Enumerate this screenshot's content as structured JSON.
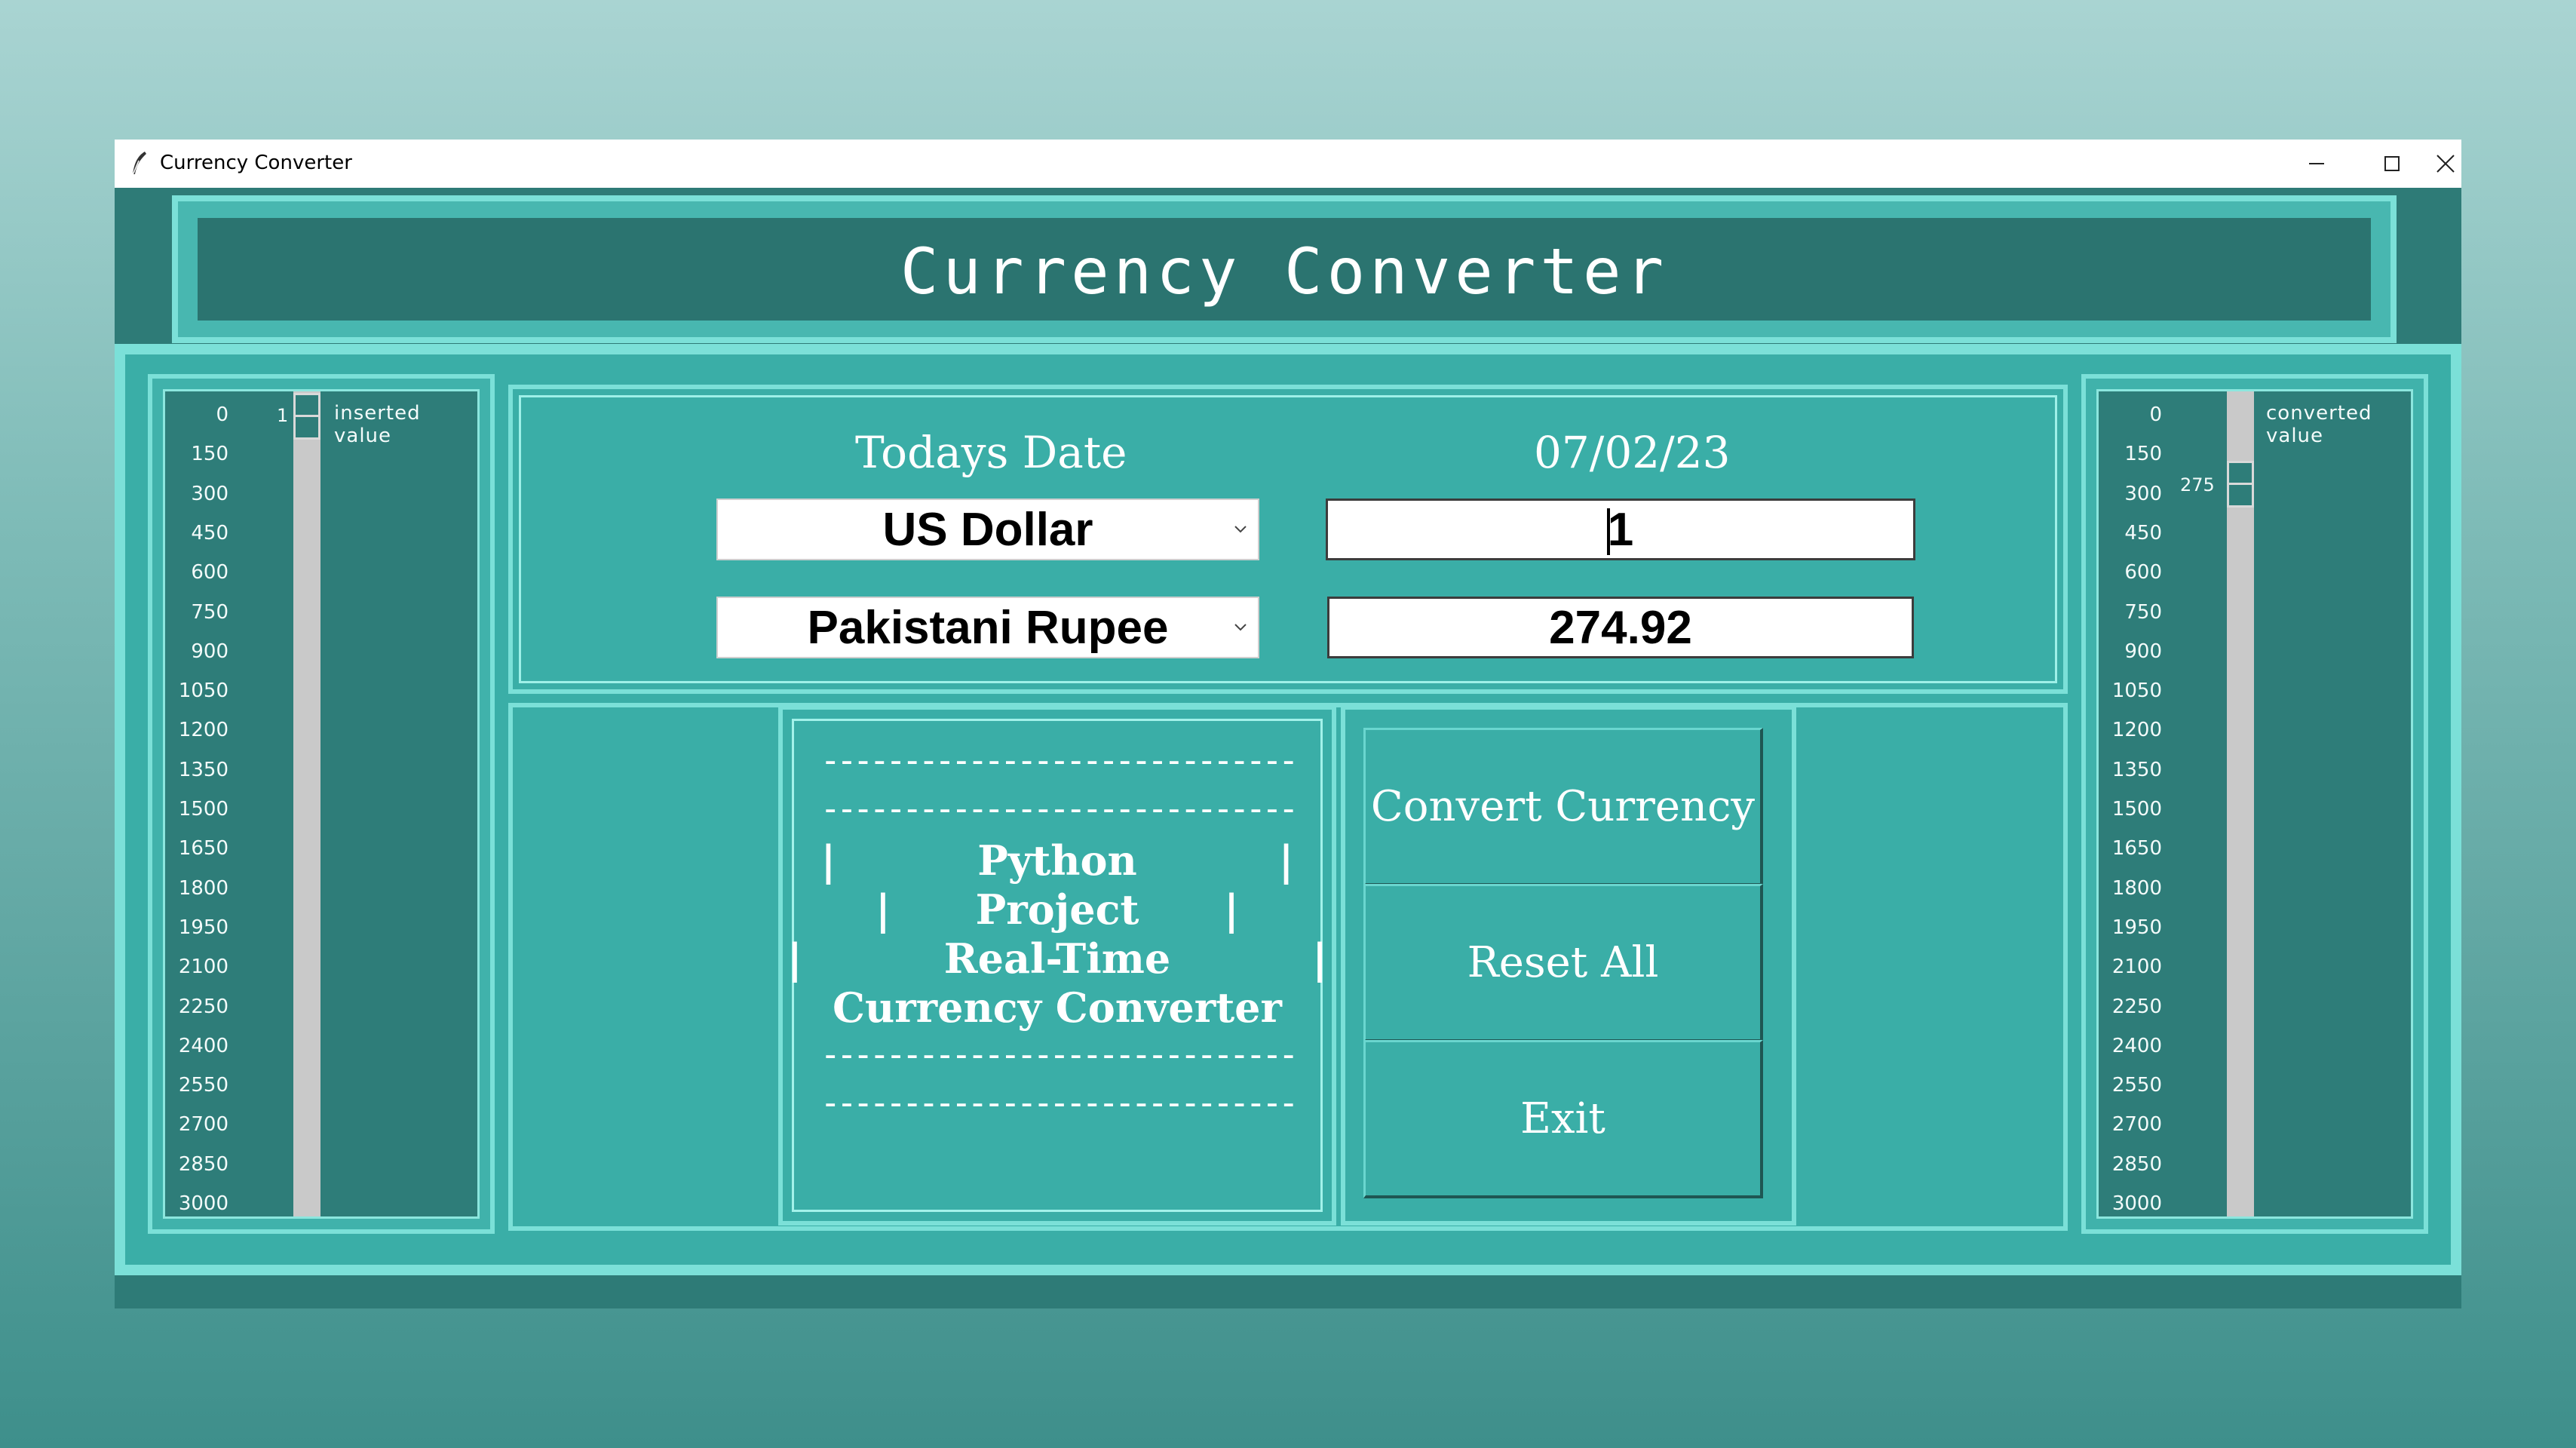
{
  "window": {
    "title": "Currency Converter",
    "controls": [
      "minimize",
      "maximize",
      "close"
    ]
  },
  "header": {
    "title": "Currency Converter"
  },
  "scales": {
    "ticks": [
      "0",
      "150",
      "300",
      "450",
      "600",
      "750",
      "900",
      "1050",
      "1200",
      "1350",
      "1500",
      "1650",
      "1800",
      "1950",
      "2100",
      "2250",
      "2400",
      "2550",
      "2700",
      "2850",
      "3000"
    ],
    "left": {
      "label": "inserted  value",
      "value": "1",
      "range": [
        0,
        3000
      ]
    },
    "right": {
      "label": "converted  value",
      "value": "275",
      "range": [
        0,
        3000
      ]
    }
  },
  "converter": {
    "date_label": "Todays Date",
    "date_value": "07/02/23",
    "from_currency": "US Dollar",
    "to_currency": "Pakistani Rupee",
    "amount": "1",
    "result": "274.92"
  },
  "info": {
    "dash1": "-----------------------------",
    "dash2": "-----------------------------",
    "line1": "|          Python          |",
    "line2": "|      Project      |",
    "line3": "|          Real-Time          |",
    "line4": "Currency Converter",
    "dash3": "-----------------------------",
    "dash4": "-----------------------------"
  },
  "buttons": {
    "convert": "Convert Currency",
    "reset": "Reset All",
    "exit": "Exit"
  },
  "colors": {
    "panel": "#3aaea7",
    "dark_panel": "#2e7b77",
    "border_light": "#7be0d8"
  }
}
